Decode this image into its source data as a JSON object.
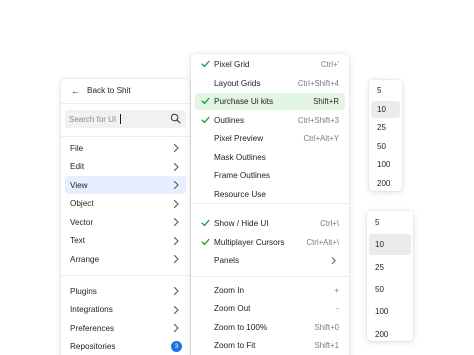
{
  "left_menu": {
    "back_label": "Back to Shit",
    "search": {
      "placeholder": "Search for UI",
      "value": ""
    },
    "groups": [
      [
        {
          "label": "File"
        },
        {
          "label": "Edit"
        },
        {
          "label": "View",
          "selected": true
        },
        {
          "label": "Object"
        },
        {
          "label": "Vector"
        },
        {
          "label": "Text"
        },
        {
          "label": "Arrange"
        }
      ],
      [
        {
          "label": "Plugins"
        },
        {
          "label": "Integrations"
        },
        {
          "label": "Preferences"
        },
        {
          "label": "Repositories",
          "badge": "3"
        }
      ]
    ]
  },
  "view_menu": {
    "items": [
      {
        "label": "Pixel Grid",
        "shortcut": "Ctrl+'",
        "checked": true
      },
      {
        "label": "Layout Grids",
        "shortcut": "Ctrl+Shift+4",
        "checked": false
      },
      {
        "label": "Purchase Ui kits",
        "shortcut": "Shift+R",
        "checked": true,
        "highlight": true
      },
      {
        "label": "Outlines",
        "shortcut": "Ctrl+Shift+3",
        "checked": true
      },
      {
        "label": "Pixel Preview",
        "shortcut": "Ctrl+Alt+Y",
        "checked": false
      },
      {
        "label": "Mask Outlines",
        "shortcut": "",
        "checked": false
      },
      {
        "label": "Frame Outlines",
        "shortcut": "",
        "checked": false
      },
      {
        "label": "Resource Use",
        "shortcut": "",
        "checked": false
      },
      {
        "label": "Show / Hide UI",
        "shortcut": "Ctrl+\\",
        "checked": true
      },
      {
        "label": "Multiplayer Cursors",
        "shortcut": "Ctrl+Alt+\\",
        "checked": true
      },
      {
        "label": "Panels",
        "shortcut": "",
        "checked": false,
        "submenu": true
      },
      {
        "label": "Zoom In",
        "shortcut": "+",
        "checked": false
      },
      {
        "label": "Zoom Out",
        "shortcut": "-",
        "checked": false
      },
      {
        "label": "Zoom to 100%",
        "shortcut": "Shift+0",
        "checked": false
      },
      {
        "label": "Zoom to Fit",
        "shortcut": "Shift+1",
        "checked": false
      }
    ]
  },
  "zoom_list_a": {
    "options": [
      "5",
      "10",
      "25",
      "50",
      "100",
      "200"
    ],
    "selected_index": 1
  },
  "zoom_list_b": {
    "options": [
      "5",
      "10",
      "25",
      "50",
      "100",
      "200"
    ],
    "selected_index": 1
  },
  "colors": {
    "accent": "#1e6fe8",
    "selected_bg": "#e6efff",
    "highlight_bg": "#e3f5e3",
    "check": "#1f9d3a"
  }
}
